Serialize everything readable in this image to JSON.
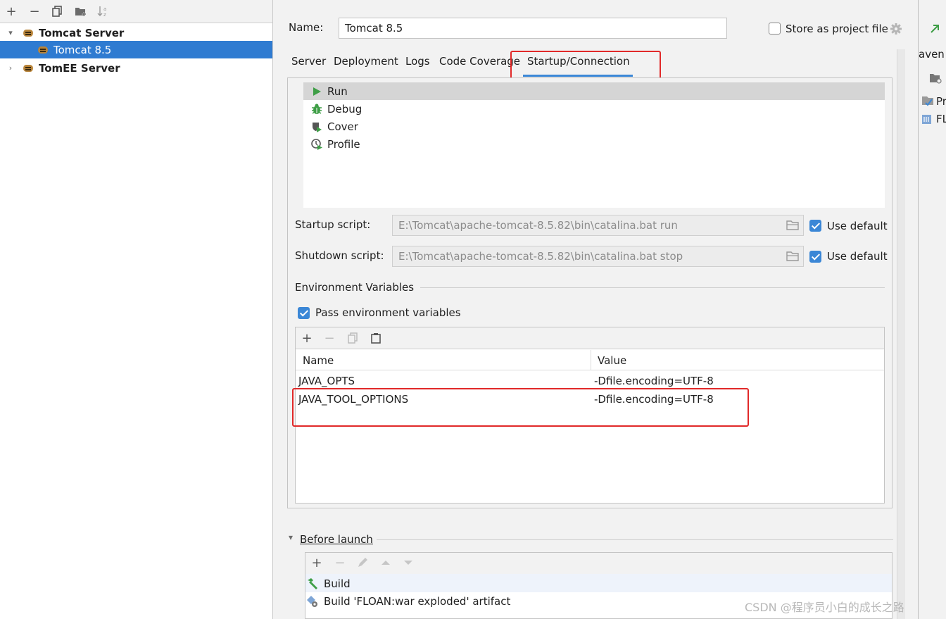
{
  "left_panel": {
    "tree": [
      {
        "label": "Tomcat Server",
        "expanded": true,
        "bold": true
      },
      {
        "label": "Tomcat 8.5",
        "selected": true,
        "bold": false
      },
      {
        "label": "TomEE Server",
        "expanded": false,
        "bold": true
      }
    ]
  },
  "header": {
    "name_label": "Name:",
    "name_value": "Tomcat 8.5",
    "store_label": "Store as project file"
  },
  "tabs": [
    {
      "label": "Server"
    },
    {
      "label": "Deployment"
    },
    {
      "label": "Logs"
    },
    {
      "label": "Code Coverage"
    },
    {
      "label": "Startup/Connection",
      "active": true
    }
  ],
  "modes": [
    {
      "label": "Run",
      "icon": "run-icon",
      "selected": true
    },
    {
      "label": "Debug",
      "icon": "debug-icon"
    },
    {
      "label": "Cover",
      "icon": "cover-icon"
    },
    {
      "label": "Profile",
      "icon": "profile-icon"
    }
  ],
  "startup": {
    "label": "Startup script:",
    "value": "E:\\Tomcat\\apache-tomcat-8.5.82\\bin\\catalina.bat run",
    "use_default_label": "Use default",
    "use_default": true
  },
  "shutdown": {
    "label": "Shutdown script:",
    "value": "E:\\Tomcat\\apache-tomcat-8.5.82\\bin\\catalina.bat stop",
    "use_default_label": "Use default",
    "use_default": true
  },
  "env": {
    "section_title": "Environment Variables",
    "pass_label": "Pass environment variables",
    "pass_checked": true,
    "columns": [
      "Name",
      "Value"
    ],
    "rows": [
      {
        "name": "JAVA_OPTS",
        "value": "-Dfile.encoding=UTF-8"
      },
      {
        "name": "JAVA_TOOL_OPTIONS",
        "value": "-Dfile.encoding=UTF-8"
      }
    ]
  },
  "before_launch": {
    "title": "Before launch",
    "items": [
      {
        "label": "Build",
        "icon": "hammer-icon"
      },
      {
        "label": "Build 'FLOAN:war exploded' artifact",
        "icon": "artifact-icon"
      }
    ]
  },
  "ide_strip": {
    "labels": [
      "aven",
      "Pr",
      "FL"
    ]
  },
  "watermark": "CSDN @程序员小白的成长之路",
  "colors": {
    "accent": "#3b87d6",
    "selection": "#2f7bd1",
    "highlight_box": "#e12929",
    "run_green": "#3e9e46"
  }
}
